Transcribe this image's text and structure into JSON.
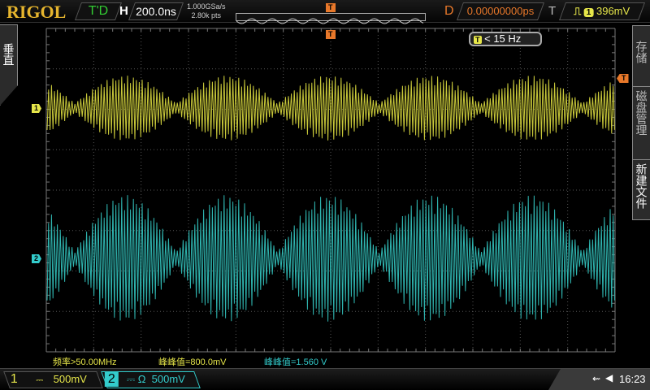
{
  "header": {
    "brand": "RIGOL",
    "run_state": "T'D",
    "h_label": "H",
    "timebase": "200.0ns",
    "sample_rate": "1.000GSa/s",
    "memory_depth": "2.80k pts",
    "d_label": "D",
    "delay": "0.00000000ps",
    "t_label": "T",
    "trigger_source": "1",
    "trigger_level": "396mV",
    "trigger_marker": "T"
  },
  "trigger_freq": {
    "icon": "T",
    "text": "< 15 Hz"
  },
  "left_menu": {
    "label": "垂直"
  },
  "right_menu": {
    "items": [
      "存储",
      "磁盘管理",
      "新建文件"
    ]
  },
  "markers": {
    "ch1": "1",
    "ch2": "2",
    "trig_level": "T"
  },
  "measurements": [
    {
      "text": "频率>50.00MHz",
      "color": "#e6e64a"
    },
    {
      "text": "峰峰值=800.0mV",
      "color": "#e6e64a"
    },
    {
      "text": "峰峰值=1.560 V",
      "color": "#33cccc"
    }
  ],
  "channels": [
    {
      "num": "1",
      "coupling": "⎓",
      "scale": "500mV",
      "color": "#e6e64a"
    },
    {
      "num": "2",
      "coupling": "⎓ Ω",
      "scale": "500mV",
      "color": "#33cccc"
    }
  ],
  "status": {
    "usb_icon": "usb-icon",
    "speaker_icon": "speaker-icon",
    "time": "16:23"
  }
}
